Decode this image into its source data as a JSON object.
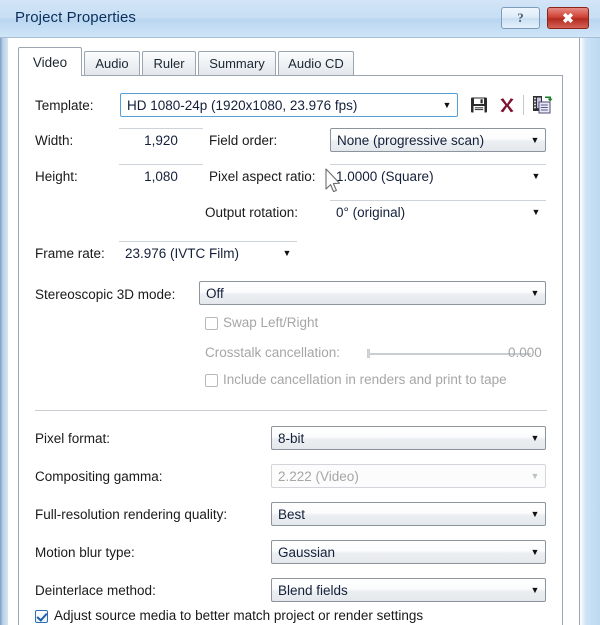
{
  "window": {
    "title": "Project Properties",
    "help_label": "?",
    "close_label": "✖"
  },
  "tabs": [
    {
      "label": "Video",
      "active": true
    },
    {
      "label": "Audio",
      "active": false
    },
    {
      "label": "Ruler",
      "active": false
    },
    {
      "label": "Summary",
      "active": false
    },
    {
      "label": "Audio CD",
      "active": false
    }
  ],
  "video": {
    "template": {
      "label": "Template:",
      "value": "HD 1080-24p (1920x1080, 23.976 fps)",
      "save_icon": "save-floppy-icon",
      "delete_icon": "delete-x-icon",
      "properties_icon": "film-properties-icon"
    },
    "width": {
      "label": "Width:",
      "value": "1,920"
    },
    "height": {
      "label": "Height:",
      "value": "1,080"
    },
    "field_order": {
      "label": "Field order:",
      "value": "None (progressive scan)"
    },
    "pixel_aspect_ratio": {
      "label": "Pixel aspect ratio:",
      "value": "1.0000 (Square)"
    },
    "output_rotation": {
      "label": "Output rotation:",
      "value": "0° (original)"
    },
    "frame_rate": {
      "label": "Frame rate:",
      "value": "23.976 (IVTC Film)"
    },
    "stereoscopic_3d_mode": {
      "label": "Stereoscopic 3D mode:",
      "value": "Off"
    },
    "swap_left_right": {
      "label": "Swap Left/Right",
      "checked": false,
      "enabled": false
    },
    "crosstalk_cancellation": {
      "label": "Crosstalk cancellation:",
      "value": "0.000",
      "enabled": false
    },
    "include_cancellation": {
      "label": "Include cancellation in renders and print to tape",
      "checked": false,
      "enabled": false
    },
    "pixel_format": {
      "label": "Pixel format:",
      "value": "8-bit"
    },
    "compositing_gamma": {
      "label": "Compositing gamma:",
      "value": "2.222 (Video)",
      "enabled": false
    },
    "full_resolution_rendering_quality": {
      "label": "Full-resolution rendering quality:",
      "value": "Best"
    },
    "motion_blur_type": {
      "label": "Motion blur type:",
      "value": "Gaussian"
    },
    "deinterlace_method": {
      "label": "Deinterlace method:",
      "value": "Blend fields"
    },
    "adjust_source_media": {
      "label": "Adjust source media to better match project or render settings",
      "checked": true
    }
  },
  "colors": {
    "titlebar_text": "#0b2f5c",
    "accent_blue": "#5a9fd4",
    "close_red": "#cf4337",
    "disabled_gray": "#a6a6a6"
  }
}
